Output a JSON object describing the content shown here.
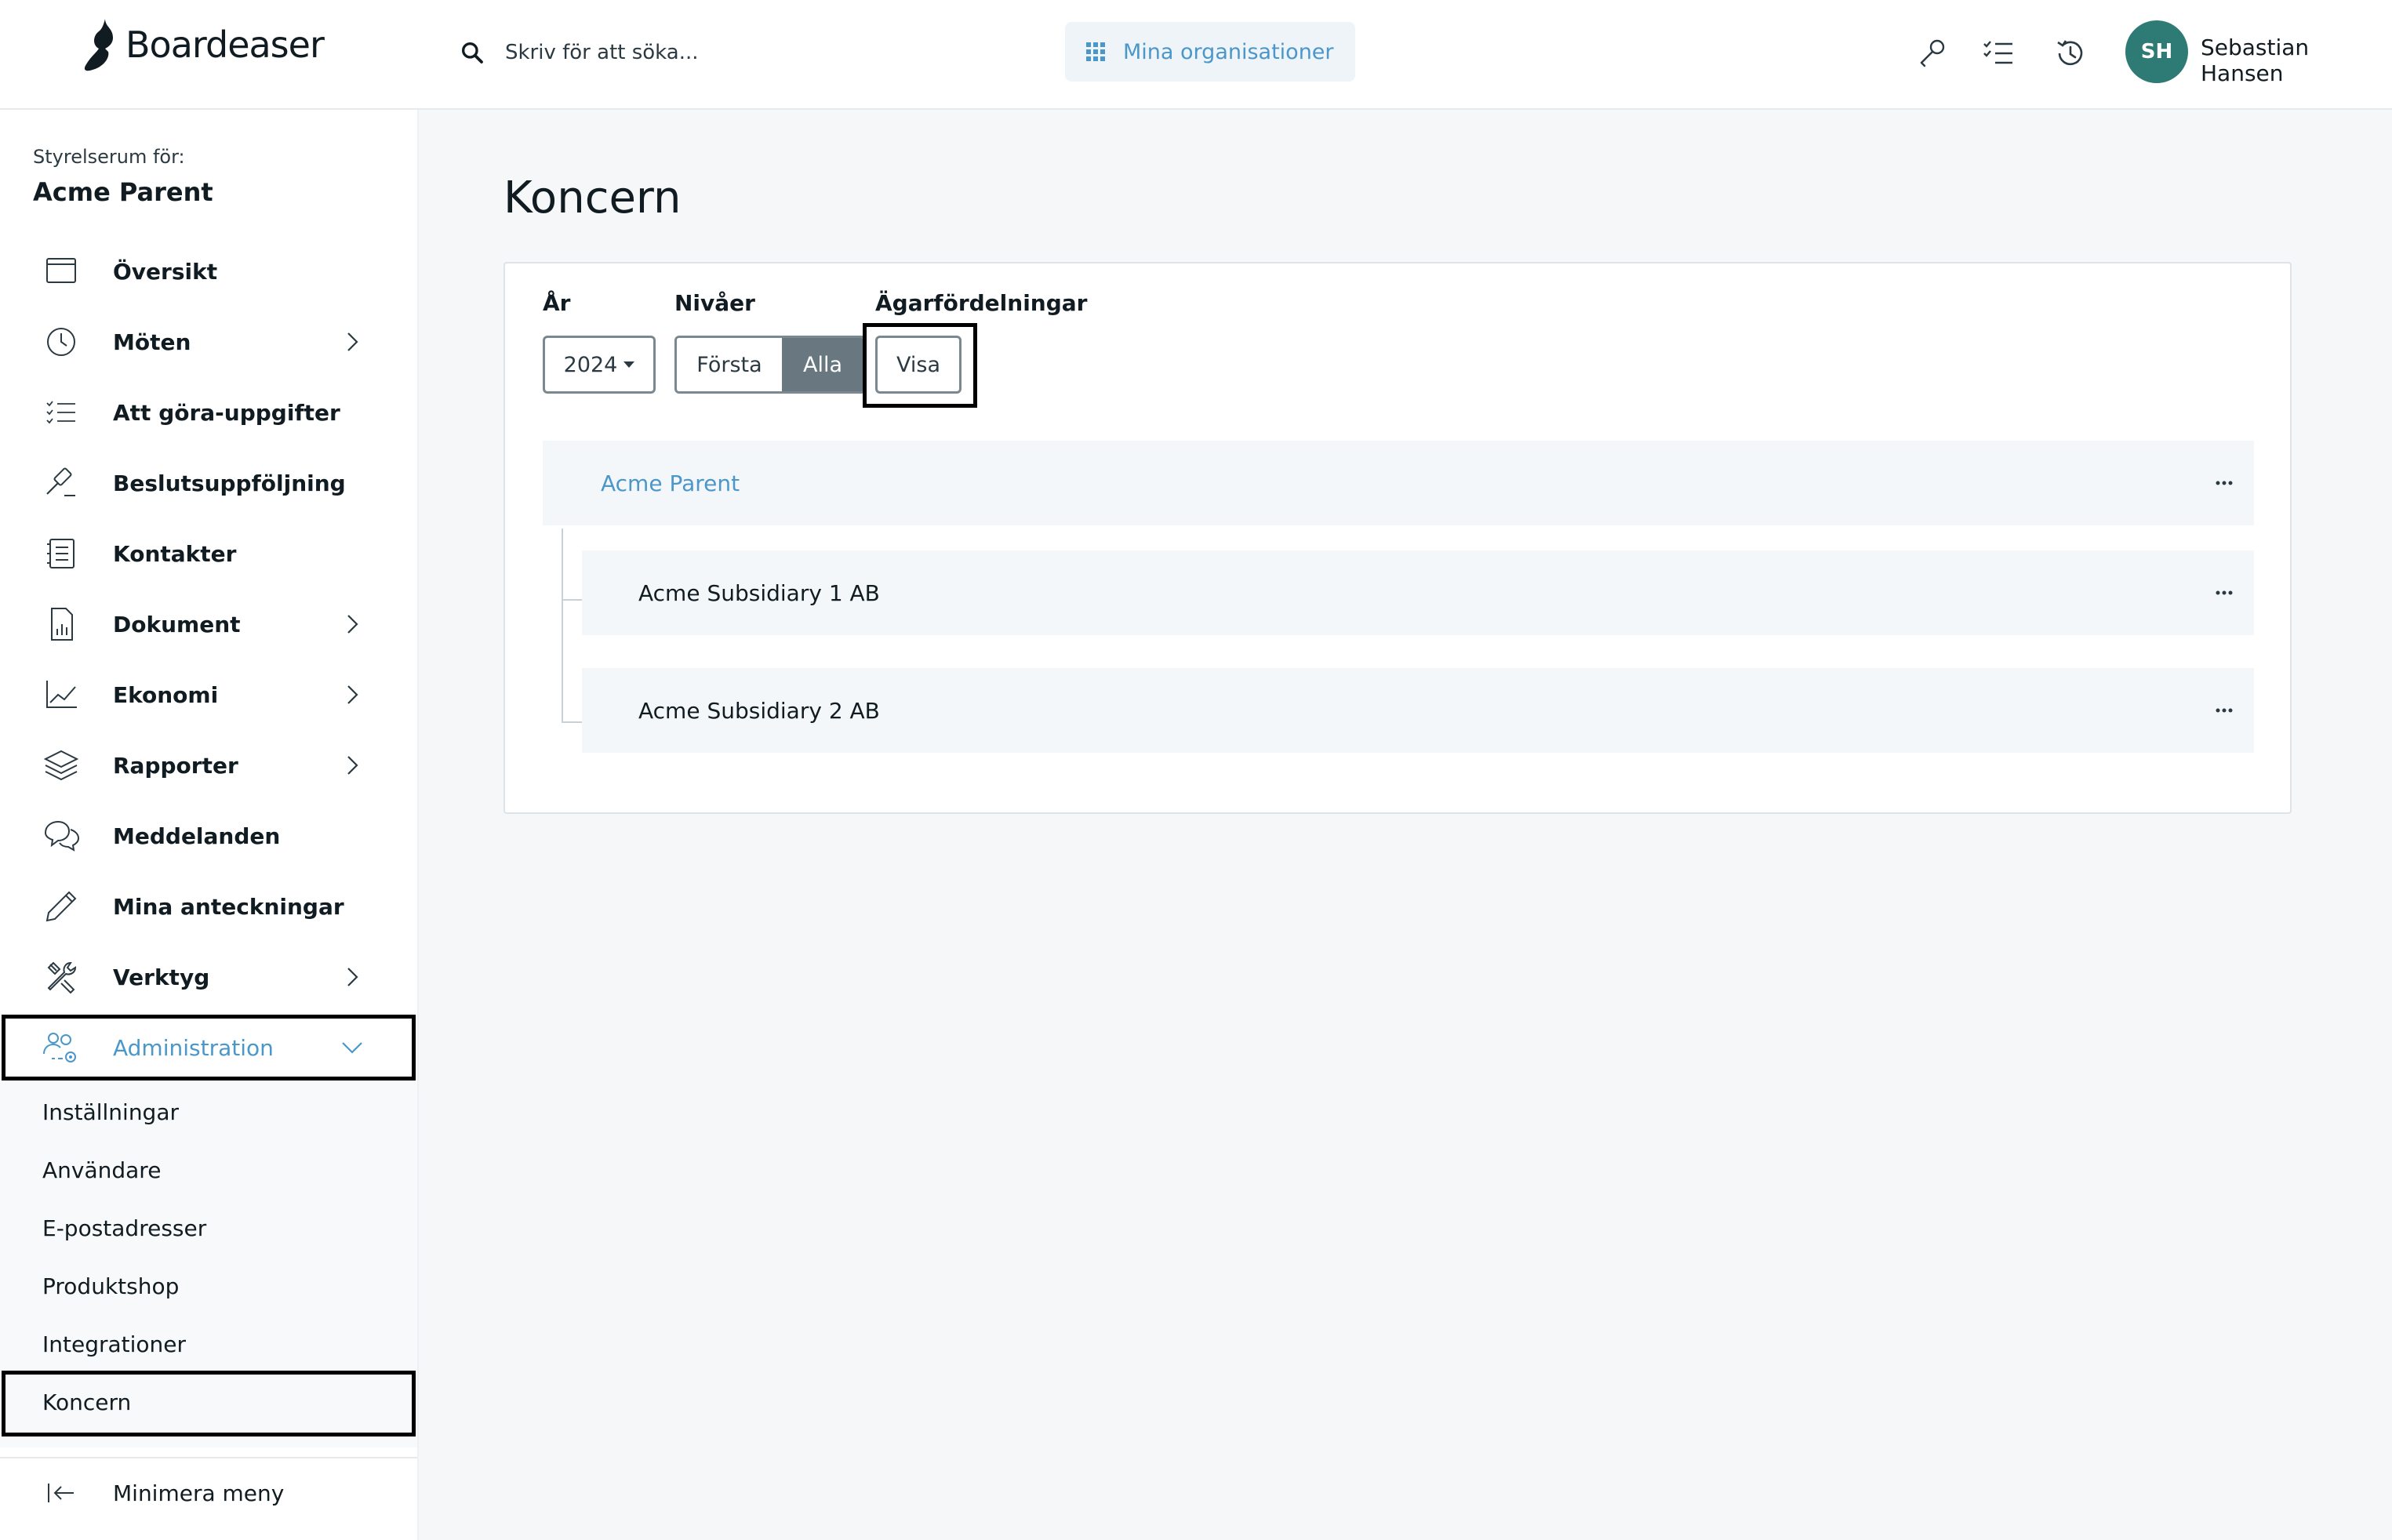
{
  "header": {
    "brand": "Boardeaser",
    "search_placeholder": "Skriv för att söka...",
    "org_button_label": "Mina organisationer",
    "tools": [
      "key-icon",
      "checklist-icon",
      "history-icon"
    ],
    "user": {
      "initials": "SH",
      "name": "Sebastian Hansen"
    }
  },
  "sidebar": {
    "caption": "Styrelserum för:",
    "org_name": "Acme Parent",
    "items": [
      {
        "label": "Översikt",
        "icon": "browser-window-icon",
        "chevron": false
      },
      {
        "label": "Möten",
        "icon": "clock-icon",
        "chevron": true
      },
      {
        "label": "Att göra-uppgifter",
        "icon": "checklist-icon",
        "chevron": false
      },
      {
        "label": "Beslutsuppföljning",
        "icon": "gavel-icon",
        "chevron": false
      },
      {
        "label": "Kontakter",
        "icon": "address-book-icon",
        "chevron": false
      },
      {
        "label": "Dokument",
        "icon": "document-chart-icon",
        "chevron": true
      },
      {
        "label": "Ekonomi",
        "icon": "line-chart-icon",
        "chevron": true
      },
      {
        "label": "Rapporter",
        "icon": "layers-icon",
        "chevron": true
      },
      {
        "label": "Meddelanden",
        "icon": "chat-bubbles-icon",
        "chevron": false
      },
      {
        "label": "Mina anteckningar",
        "icon": "pencil-icon",
        "chevron": false
      },
      {
        "label": "Verktyg",
        "icon": "tools-icon",
        "chevron": true
      },
      {
        "label": "Administration",
        "icon": "users-settings-icon",
        "chevron": "expanded",
        "active": true
      }
    ],
    "admin_sub_items": [
      {
        "label": "Inställningar"
      },
      {
        "label": "Användare"
      },
      {
        "label": "E-postadresser"
      },
      {
        "label": "Produktshop"
      },
      {
        "label": "Integrationer"
      },
      {
        "label": "Koncern",
        "selected": true
      }
    ],
    "minimize_label": "Minimera meny"
  },
  "main": {
    "title": "Koncern",
    "filters": {
      "year_label": "År",
      "year_value": "2024",
      "levels_label": "Nivåer",
      "levels_options": [
        "Första",
        "Alla"
      ],
      "levels_selected": "Alla",
      "ownership_label": "Ägarfördelningar",
      "ownership_button": "Visa"
    },
    "tree": {
      "root": "Acme Parent",
      "children": [
        "Acme Subsidiary 1 AB",
        "Acme Subsidiary 2 AB"
      ]
    }
  },
  "colors": {
    "accent": "#4b97c9",
    "avatar": "#2e7a75",
    "segment_active": "#687780",
    "background_main": "#f5f7f8"
  }
}
